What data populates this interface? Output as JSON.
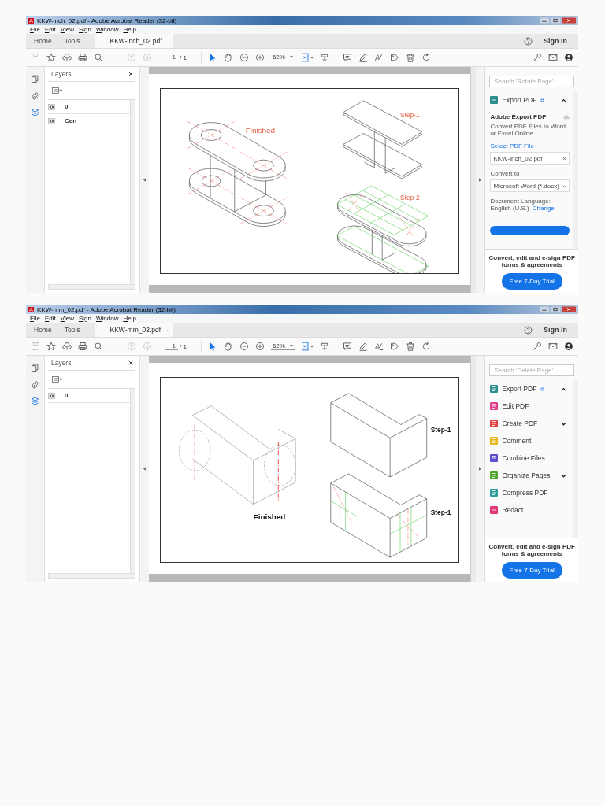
{
  "windows": [
    {
      "title": "KKW-inch_02.pdf - Adobe Acrobat Reader (32-bit)",
      "menu": [
        "File",
        "Edit",
        "View",
        "Sign",
        "Window",
        "Help"
      ],
      "tabs": [
        {
          "label": "Home",
          "selected": false,
          "kind": "nav"
        },
        {
          "label": "Tools",
          "selected": false,
          "kind": "nav"
        },
        {
          "label": "KKW-inch_02.pdf",
          "selected": true,
          "kind": "document"
        }
      ],
      "sign_in": "Sign In",
      "page_number": "1",
      "page_total": "/ 1",
      "zoom": "62%",
      "layers_panel": {
        "title": "Layers",
        "layers": [
          {
            "name": "0",
            "visible": true
          },
          {
            "name": "Cen",
            "visible": true
          }
        ]
      },
      "page": {
        "kind": "link",
        "labels": [
          "Finished",
          "Step-1",
          "Step-2"
        ]
      },
      "right_pane": {
        "search_placeholder": "Search 'Rotate Page'",
        "tools": [
          {
            "label": "Export PDF",
            "color": "#2a8c8c",
            "gear": true,
            "expanded": true
          }
        ],
        "export": {
          "heading": "Adobe Export PDF",
          "description": "Convert PDF Files to Word or Excel Online",
          "select_label": "Select PDF File",
          "file": "KKW-inch_02.pdf",
          "convert_label": "Convert to",
          "format": "Microsoft Word (*.docx)",
          "language_label": "Document Language:",
          "language": "English (U.S.)",
          "change_link": "Change"
        }
      },
      "promo": {
        "text": "Convert, edit and e-sign PDF forms & agreements",
        "button": "Free 7-Day Trial"
      }
    },
    {
      "title": "KKW-mm_02.pdf - Adobe Acrobat Reader (32-bit)",
      "menu": [
        "File",
        "Edit",
        "View",
        "Sign",
        "Window",
        "Help"
      ],
      "tabs": [
        {
          "label": "Home",
          "selected": false,
          "kind": "nav"
        },
        {
          "label": "Tools",
          "selected": false,
          "kind": "nav"
        },
        {
          "label": "KKW-mm_02.pdf",
          "selected": true,
          "kind": "document"
        }
      ],
      "sign_in": "Sign In",
      "page_number": "1",
      "page_total": "/ 1",
      "zoom": "62%",
      "layers_panel": {
        "title": "Layers",
        "layers": [
          {
            "name": "0",
            "visible": true
          }
        ]
      },
      "page": {
        "kind": "bracket",
        "labels": [
          "Finished",
          "Step-1",
          "Step-1"
        ]
      },
      "right_pane": {
        "search_placeholder": "Search 'Delete Page'",
        "tools": [
          {
            "label": "Export PDF",
            "color": "#2a8c8c",
            "gear": true,
            "expanded": true
          },
          {
            "label": "Edit PDF",
            "color": "#e0408a",
            "gear": false
          },
          {
            "label": "Create PDF",
            "color": "#e04848",
            "gear": false,
            "expanded": false
          },
          {
            "label": "Comment",
            "color": "#e8b820",
            "gear": false
          },
          {
            "label": "Combine Files",
            "color": "#5a50d0",
            "gear": false
          },
          {
            "label": "Organize Pages",
            "color": "#50a830",
            "gear": false,
            "expanded": false
          },
          {
            "label": "Compress PDF",
            "color": "#2a9c9c",
            "gear": false
          },
          {
            "label": "Redact",
            "color": "#e03878",
            "gear": false
          }
        ]
      },
      "promo": {
        "text": "Convert, edit and e-sign PDF forms & agreements",
        "button": "Free 7-Day Trial"
      }
    }
  ]
}
